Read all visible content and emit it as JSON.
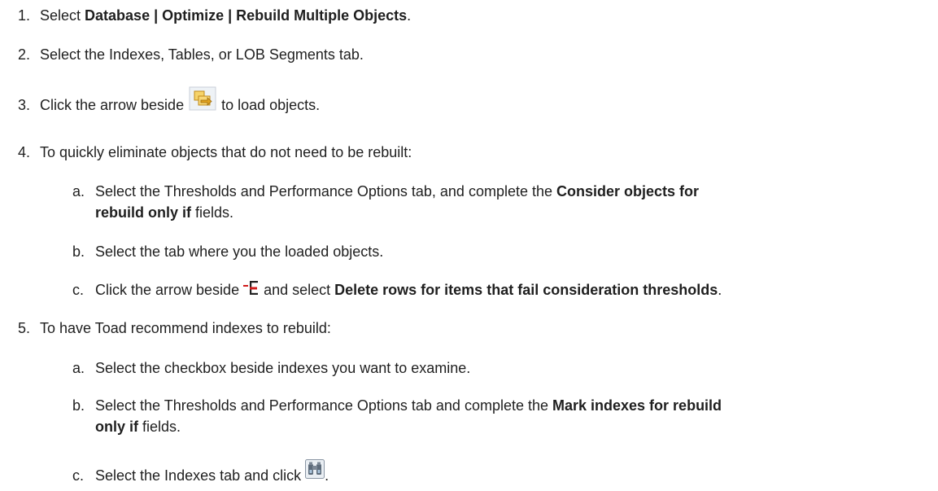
{
  "steps": [
    {
      "num": "1.",
      "text_before": "Select ",
      "bold": "Database | Optimize | Rebuild Multiple Objects",
      "text_after": "."
    },
    {
      "num": "2.",
      "text": "Select the Indexes, Tables, or LOB Segments tab."
    },
    {
      "num": "3.",
      "text_before": "Click the arrow beside ",
      "icon": "load-objects-icon",
      "text_after": " to load objects."
    },
    {
      "num": "4.",
      "text": "To quickly eliminate objects that do not need to be rebuilt:",
      "sub": [
        {
          "letter": "a.",
          "text_before": "Select the Thresholds and Performance Options tab, and complete the ",
          "bold": "Consider objects for",
          "bold2": "rebuild only if",
          "text_after": " fields."
        },
        {
          "letter": "b.",
          "text": "Select the tab where you the loaded objects."
        },
        {
          "letter": "c.",
          "text_before": "Click the arrow beside ",
          "icon": "delete-rows-icon",
          "text_mid": " and select ",
          "bold": "Delete rows for items that fail consideration thresholds",
          "text_after": "."
        }
      ]
    },
    {
      "num": "5.",
      "text": "To have Toad recommend indexes to rebuild:",
      "sub": [
        {
          "letter": "a.",
          "text": "Select the checkbox beside indexes you want to examine."
        },
        {
          "letter": "b.",
          "text_before": "Select the Thresholds and Performance Options tab and complete the ",
          "bold": "Mark indexes for rebuild",
          "bold2": "only if",
          "text_after": " fields."
        },
        {
          "letter": "c.",
          "text_before": "Select the Indexes tab and click ",
          "icon": "binoculars-icon",
          "text_after": "."
        }
      ]
    }
  ]
}
